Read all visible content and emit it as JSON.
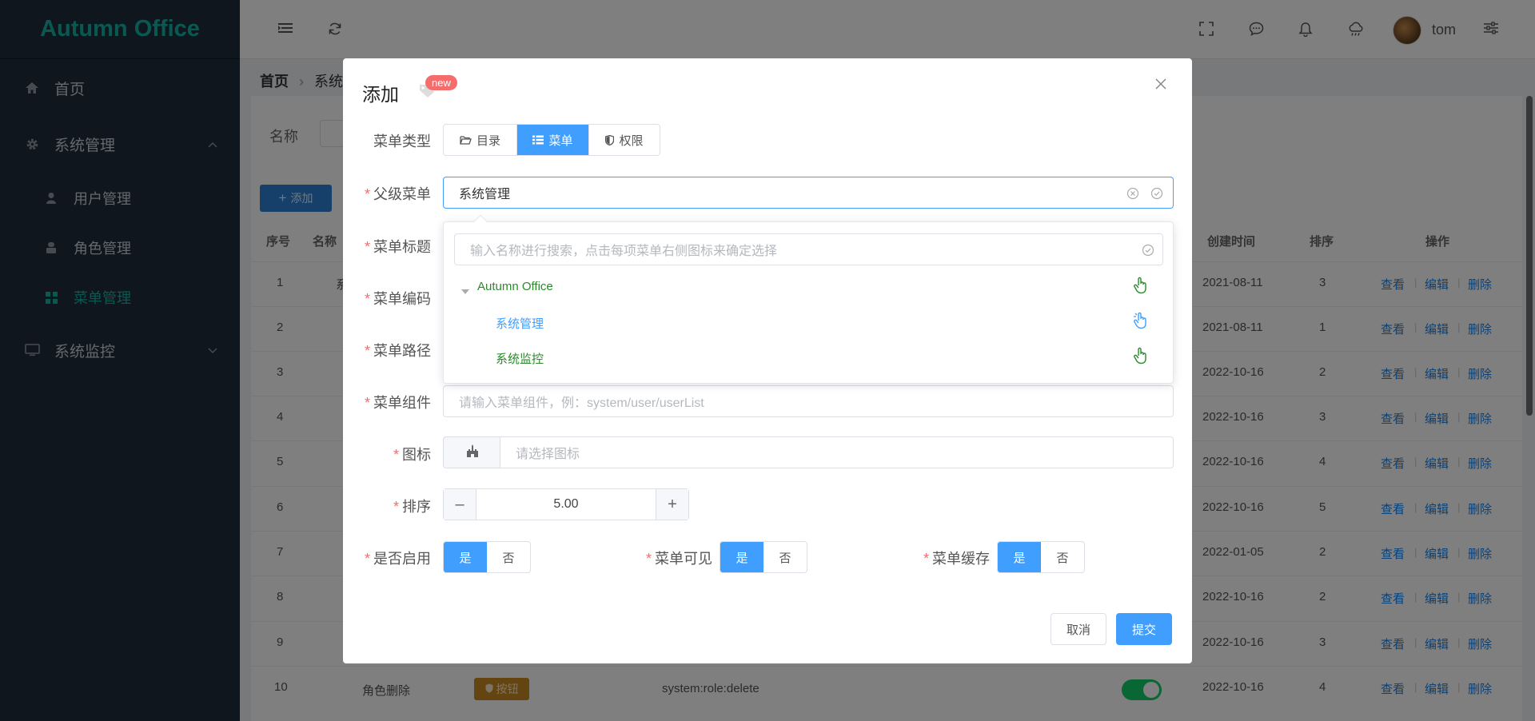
{
  "app": {
    "logo": "Autumn Office"
  },
  "sidebar": {
    "items": [
      {
        "label": "首页",
        "icon": "home-icon"
      },
      {
        "label": "系统管理",
        "icon": "gear-icon"
      },
      {
        "label": "用户管理",
        "icon": "user-icon"
      },
      {
        "label": "角色管理",
        "icon": "role-icon"
      },
      {
        "label": "菜单管理",
        "icon": "grid-icon"
      },
      {
        "label": "系统监控",
        "icon": "monitor-icon"
      }
    ]
  },
  "header": {
    "username": "tom"
  },
  "page": {
    "breadcrumb": {
      "home": "首页",
      "current": "系统"
    },
    "search_label": "名称",
    "add_label": "添加",
    "table_headers": {
      "index": "序号",
      "name": "名称",
      "created": "创建时间",
      "order": "排序",
      "actions": "操作"
    },
    "rows": [
      {
        "index": "1",
        "name": "系",
        "date": "2021-08-11",
        "order": "3"
      },
      {
        "index": "2",
        "name": "",
        "date": "2021-08-11",
        "order": "1"
      },
      {
        "index": "3",
        "name": "",
        "date": "2022-10-16",
        "order": "2"
      },
      {
        "index": "4",
        "name": "",
        "date": "2022-10-16",
        "order": "3"
      },
      {
        "index": "5",
        "name": "",
        "date": "2022-10-16",
        "order": "4"
      },
      {
        "index": "6",
        "name": "",
        "date": "2022-10-16",
        "order": "5"
      },
      {
        "index": "7",
        "name": "",
        "date": "2022-01-05",
        "order": "2"
      },
      {
        "index": "8",
        "name": "",
        "date": "2022-10-16",
        "order": "2"
      },
      {
        "index": "9",
        "name": "",
        "date": "2022-10-16",
        "order": "3"
      },
      {
        "index": "10",
        "name": "角色删除",
        "date": "2022-10-16",
        "order": "4",
        "type_label": "按钮",
        "code": "system:role:delete"
      }
    ],
    "actions": {
      "view": "查看",
      "edit": "编辑",
      "delete": "删除"
    }
  },
  "dialog": {
    "title": "添加",
    "badge": "new",
    "labels": {
      "menu_type": "菜单类型",
      "parent": "父级菜单",
      "title": "菜单标题",
      "code": "菜单编码",
      "path": "菜单路径",
      "component": "菜单组件",
      "icon": "图标",
      "order": "排序",
      "enabled": "是否启用",
      "visible": "菜单可见",
      "cache": "菜单缓存"
    },
    "menu_types": [
      "目录",
      "菜单",
      "权限"
    ],
    "parent_value": "系统管理",
    "tree_search_placeholder": "输入名称进行搜索，点击每项菜单右侧图标来确定选择",
    "tree": [
      {
        "label": "Autumn Office"
      },
      {
        "label": "系统管理"
      },
      {
        "label": "系统监控"
      }
    ],
    "component_placeholder": "请输入菜单组件，例：system/user/userList",
    "icon_placeholder": "请选择图标",
    "order_value": "5.00",
    "yes": "是",
    "no": "否",
    "cancel": "取消",
    "submit": "提交"
  }
}
